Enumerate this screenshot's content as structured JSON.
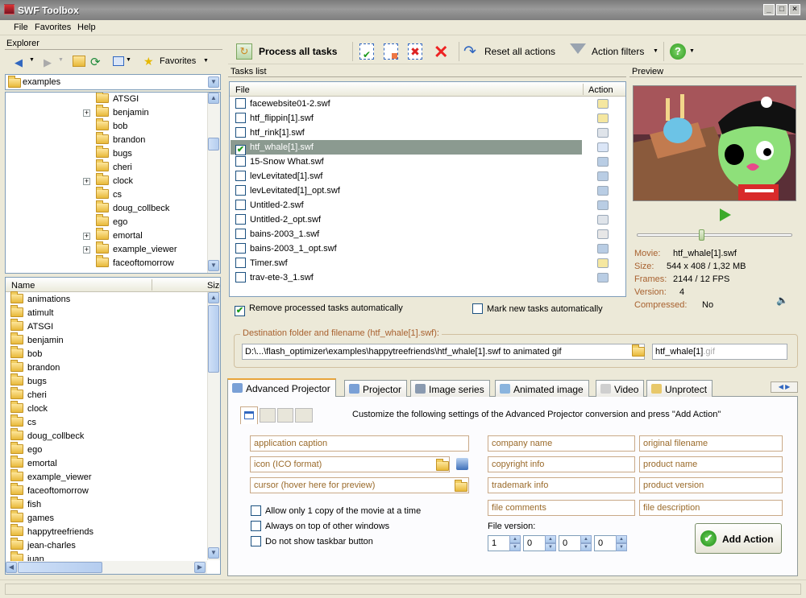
{
  "app": {
    "title": "SWF Toolbox"
  },
  "menu": [
    "File",
    "Favorites",
    "Help"
  ],
  "explorer": {
    "header": "Explorer",
    "favorites_label": "Favorites",
    "path": "examples",
    "tree": [
      {
        "label": "ATSGI",
        "expandable": false
      },
      {
        "label": "benjamin",
        "expandable": true
      },
      {
        "label": "bob",
        "expandable": false
      },
      {
        "label": "brandon",
        "expandable": false
      },
      {
        "label": "bugs",
        "expandable": false
      },
      {
        "label": "cheri",
        "expandable": false
      },
      {
        "label": "clock",
        "expandable": true
      },
      {
        "label": "cs",
        "expandable": false
      },
      {
        "label": "doug_collbeck",
        "expandable": false
      },
      {
        "label": "ego",
        "expandable": false
      },
      {
        "label": "emortal",
        "expandable": true
      },
      {
        "label": "example_viewer",
        "expandable": true
      },
      {
        "label": "faceoftomorrow",
        "expandable": false
      }
    ],
    "list_cols": {
      "name": "Name",
      "size": "Size"
    },
    "list": [
      "animations",
      "atimult",
      "ATSGI",
      "benjamin",
      "bob",
      "brandon",
      "bugs",
      "cheri",
      "clock",
      "cs",
      "doug_collbeck",
      "ego",
      "emortal",
      "example_viewer",
      "faceoftomorrow",
      "fish",
      "games",
      "happytreefriends",
      "jean-charles",
      "juan"
    ]
  },
  "toolbar": {
    "process_all": "Process all tasks",
    "reset_all": "Reset all actions",
    "action_filters": "Action filters"
  },
  "tasks": {
    "header": "Tasks list",
    "col_file": "File",
    "col_action": "Action",
    "rows": [
      {
        "file": "facewebsite01-2.swf",
        "checked": false,
        "selected": false
      },
      {
        "file": "htf_flippin[1].swf",
        "checked": false,
        "selected": false
      },
      {
        "file": "htf_rink[1].swf",
        "checked": false,
        "selected": false
      },
      {
        "file": "htf_whale[1].swf",
        "checked": true,
        "selected": true
      },
      {
        "file": "15-Snow What.swf",
        "checked": false,
        "selected": false
      },
      {
        "file": "levLevitated[1].swf",
        "checked": false,
        "selected": false
      },
      {
        "file": "levLevitated[1]_opt.swf",
        "checked": false,
        "selected": false
      },
      {
        "file": "Untitled-2.swf",
        "checked": false,
        "selected": false
      },
      {
        "file": "Untitled-2_opt.swf",
        "checked": false,
        "selected": false
      },
      {
        "file": "bains-2003_1.swf",
        "checked": false,
        "selected": false
      },
      {
        "file": "bains-2003_1_opt.swf",
        "checked": false,
        "selected": false
      },
      {
        "file": "Timer.swf",
        "checked": false,
        "selected": false
      },
      {
        "file": "trav-ete-3_1.swf",
        "checked": false,
        "selected": false
      }
    ],
    "remove_processed": "Remove processed tasks automatically",
    "mark_new": "Mark new tasks automatically"
  },
  "preview": {
    "header": "Preview",
    "movie_label": "Movie:",
    "movie": "htf_whale[1].swf",
    "size_label": "Size:",
    "size": "544 x 408 / 1,32 MB",
    "frames_label": "Frames:",
    "frames": "2144 / 12 FPS",
    "version_label": "Version:",
    "version": "4",
    "compressed_label": "Compressed:",
    "compressed": "No",
    "seek_fraction": 0.4
  },
  "destination": {
    "legend": "Destination folder and filename (htf_whale[1].swf):",
    "path": "D:\\...\\flash_optimizer\\examples\\happytreefriends\\htf_whale[1].swf to animated gif",
    "filename": "htf_whale[1]",
    "ext": ".gif"
  },
  "tabs": [
    "Advanced Projector",
    "Projector",
    "Image series",
    "Animated image",
    "Video",
    "Unprotect"
  ],
  "advanced": {
    "instruction": "Customize the following settings of the Advanced Projector conversion and press \"Add Action\"",
    "fields_left": [
      "application caption",
      "icon (ICO format)",
      "cursor (hover here for preview)"
    ],
    "fields_mid": [
      "company name",
      "copyright info",
      "trademark info",
      "file comments"
    ],
    "fields_right": [
      "original filename",
      "product name",
      "product version",
      "file description"
    ],
    "options": [
      "Allow only 1 copy of the movie at a time",
      "Always on top of other windows",
      "Do not show taskbar button"
    ],
    "file_version_label": "File version:",
    "file_version": [
      "1",
      "0",
      "0",
      "0"
    ],
    "add_action": "Add Action"
  },
  "colors": {
    "accent": "#3a6ea5",
    "field_text": "#9a6a2a",
    "label": "#a8612f"
  }
}
